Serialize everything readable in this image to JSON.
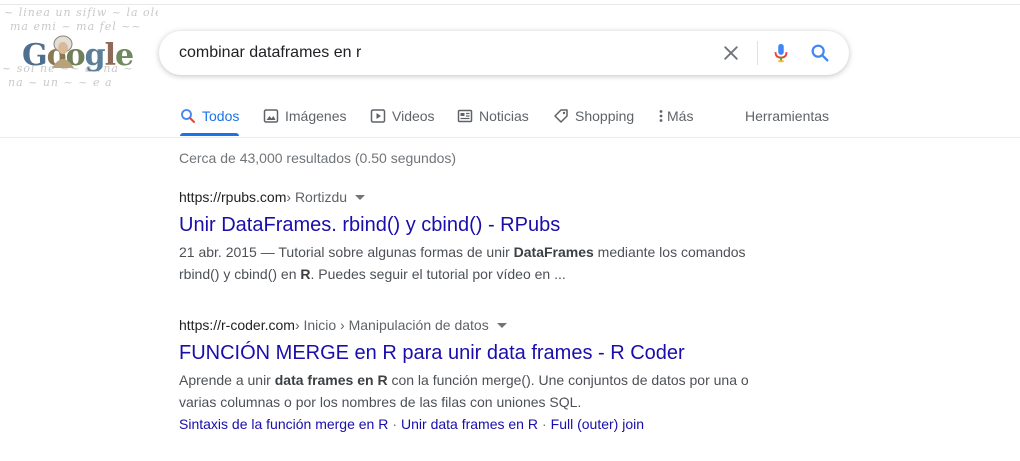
{
  "search": {
    "query": "combinar dataframes en r",
    "logo_text": "Google"
  },
  "tabs": [
    {
      "label": "Todos",
      "icon": "search-icon",
      "active": true
    },
    {
      "label": "Imágenes",
      "icon": "image-icon"
    },
    {
      "label": "Videos",
      "icon": "play-icon"
    },
    {
      "label": "Noticias",
      "icon": "news-icon"
    },
    {
      "label": "Shopping",
      "icon": "tag-icon"
    },
    {
      "label": "Más",
      "icon": "more-vert-icon"
    },
    {
      "label": "Herramientas"
    }
  ],
  "stats": "Cerca de 43,000 resultados (0.50 segundos)",
  "results": [
    {
      "url_base": "https://rpubs.com",
      "url_path": " › Rortizdu",
      "title": "Unir DataFrames. rbind() y cbind() - RPubs",
      "snippet": [
        {
          "t": "21 abr. 2015 — Tutorial sobre algunas formas de unir ",
          "b": false
        },
        {
          "t": "DataFrames",
          "b": true
        },
        {
          "t": " mediante los comandos rbind() y cbind() en ",
          "b": false
        },
        {
          "t": "R",
          "b": true
        },
        {
          "t": ". Puedes seguir el tutorial por vídeo en ...",
          "b": false
        }
      ]
    },
    {
      "url_base": "https://r-coder.com",
      "url_path": " › Inicio › Manipulación de datos",
      "title": "FUNCIÓN MERGE en R para unir data frames - R Coder",
      "snippet": [
        {
          "t": "Aprende a unir ",
          "b": false
        },
        {
          "t": "data frames en R",
          "b": true
        },
        {
          "t": " con la función merge(). Une conjuntos de datos por una o varias columnas o por los nombres de las filas con uniones SQL.",
          "b": false
        }
      ],
      "sitelinks": [
        "Sintaxis de la función merge en R",
        "Unir data frames en R",
        "Full (outer) join"
      ]
    }
  ],
  "colors": {
    "link": "#1a0dab",
    "accent": "#1a73e8",
    "muted": "#70757a"
  }
}
